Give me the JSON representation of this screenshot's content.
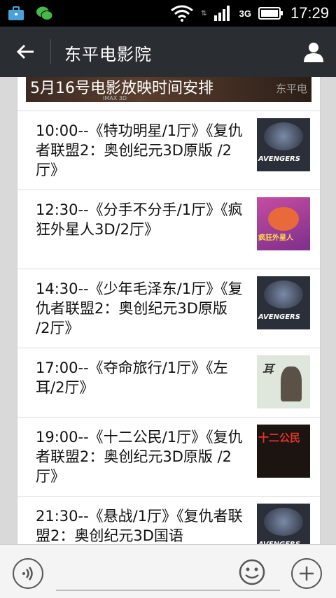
{
  "status_bar": {
    "time": "17:29",
    "network_label": "3G",
    "left_icons": [
      "briefcase-icon",
      "wechat-icon"
    ],
    "right_icons": [
      "wifi-icon",
      "signal-icon",
      "battery-icon"
    ]
  },
  "header": {
    "title": "东平电影院",
    "back_icon": "back-arrow-icon",
    "profile_icon": "person-icon"
  },
  "banner": {
    "title": "5月16号电影放映时间安排",
    "subtitle": "IMAX 3D",
    "watermark": "东平电"
  },
  "schedule": [
    {
      "text": "10:00--《特功明星/1厅》《复仇者联盟2：奥创纪元3D原版 /2厅》",
      "thumb": "avengers"
    },
    {
      "text": "12:30--《分手不分手/1厅》《疯狂外星人3D/2厅》",
      "thumb": "home"
    },
    {
      "text": "14:30--《少年毛泽东/1厅》《复仇者联盟2：奥创纪元3D原版 /2厅》",
      "thumb": "avengers"
    },
    {
      "text": "17:00--《夺命旅行/1厅》《左耳/2厅》",
      "thumb": "left-ear"
    },
    {
      "text": "19:00--《十二公民/1厅》《复仇者联盟2：奥创纪元3D原版 /2厅》",
      "thumb": "twelve"
    },
    {
      "text": "21:30--《悬战/1厅》《复仇者联盟2：奥创纪元3D国语",
      "thumb": "avengers"
    }
  ],
  "thumbs": {
    "avengers": {
      "caption": "AVENGERS",
      "bg": "#2b2f3a"
    },
    "home": {
      "caption": "疯狂外星人",
      "bg": "#b23a8a"
    },
    "left-ear": {
      "caption": "耳",
      "bg": "#dfe7dc"
    },
    "twelve": {
      "caption": "十二公民",
      "bg": "#1c1410"
    }
  },
  "input_bar": {
    "placeholder": "",
    "voice_icon": "voice-icon",
    "emoji_icon": "emoji-icon",
    "add_icon": "plus-icon"
  }
}
